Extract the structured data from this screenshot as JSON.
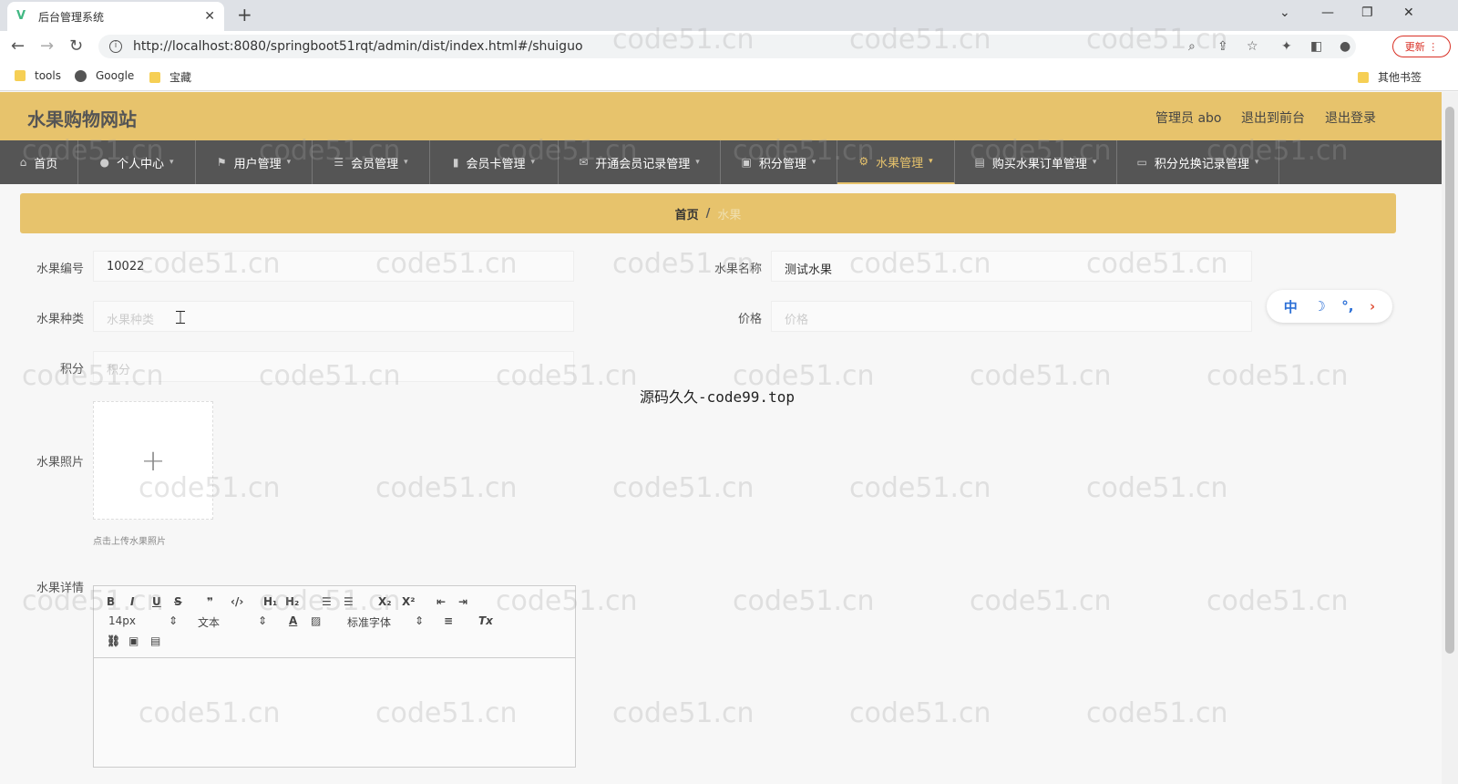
{
  "browser": {
    "tab_title": "后台管理系统",
    "tab_close": "✕",
    "new_tab": "+",
    "url": "http://localhost:8080/springboot51rqt/admin/dist/index.html#/shuiguo",
    "update_label": "更新"
  },
  "bookmarks": [
    "tools",
    "Google",
    "宝藏"
  ],
  "bookmarks_other": "其他书签",
  "app": {
    "brand": "水果购物网站",
    "user_label": "管理员 abo",
    "to_front": "退出到前台",
    "logout": "退出登录"
  },
  "menu": [
    {
      "label": "首页",
      "icon": "home-icon",
      "glyph": "⌂"
    },
    {
      "label": "个人中心",
      "icon": "user-icon",
      "glyph": "●"
    },
    {
      "label": "用户管理",
      "icon": "flag-icon",
      "glyph": "⚑"
    },
    {
      "label": "会员管理",
      "icon": "list-icon",
      "glyph": "☰"
    },
    {
      "label": "会员卡管理",
      "icon": "bar-chart-icon",
      "glyph": "▮"
    },
    {
      "label": "开通会员记录管理",
      "icon": "mail-icon",
      "glyph": "✉"
    },
    {
      "label": "积分管理",
      "icon": "trash-icon",
      "glyph": "▣"
    },
    {
      "label": "水果管理",
      "icon": "gear-icon",
      "glyph": "⚙"
    },
    {
      "label": "购买水果订单管理",
      "icon": "chat-icon",
      "glyph": "▤"
    },
    {
      "label": "积分兑换记录管理",
      "icon": "card-icon",
      "glyph": "▭"
    }
  ],
  "breadcrumb": {
    "home": "首页",
    "sep": "/",
    "current": "水果"
  },
  "form": {
    "code_label": "水果编号",
    "code_value": "10022",
    "name_label": "水果名称",
    "name_value": "测试水果",
    "type_label": "水果种类",
    "type_placeholder": "水果种类",
    "price_label": "价格",
    "price_placeholder": "价格",
    "points_label": "积分",
    "points_placeholder": "积分",
    "photo_label": "水果照片",
    "upload_plus": "+",
    "upload_tip": "点击上传水果照片",
    "detail_label": "水果详情"
  },
  "editor": {
    "font_size": "14px",
    "text_style": "文本",
    "font_family": "标准字体"
  },
  "ime": {
    "lang": "中",
    "moon": "☽",
    "punct": "°,",
    "arrow": "›"
  },
  "watermark_text": "源码久久-code99.top",
  "wm": "code51.cn"
}
